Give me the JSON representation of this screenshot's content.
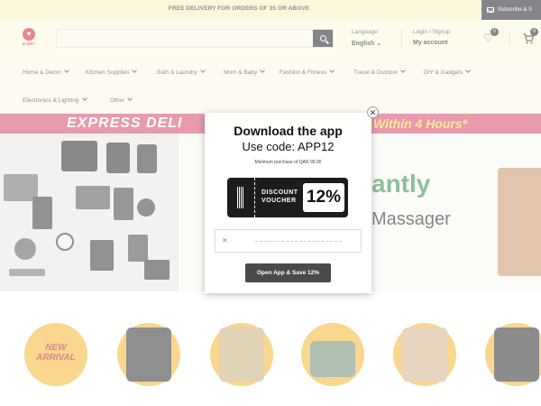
{
  "topbar": {
    "promo": "FREE DELIVERY FOR ORDERS OF 35 OR ABOVE",
    "subscribe": "Subscribe & S"
  },
  "brand": {
    "logo_text": "E-SKY"
  },
  "search": {
    "placeholder": ""
  },
  "header": {
    "language_label": "Language",
    "language_value": "English",
    "login_label": "Login / Signup",
    "account_label": "My account",
    "wishlist_count": "0",
    "cart_count": "0"
  },
  "nav": {
    "items": [
      "Home & Decor",
      "Kitchen Supplies",
      "Bath & Laundry",
      "Mom & Baby",
      "Fashion & Fitness",
      "Travel & Outdoor",
      "DIY & Gadgets",
      "Electronics & Lighting",
      "Other"
    ]
  },
  "banner": {
    "express_text": "EXPRESS DELI",
    "within_text": "Within 4 Hours*",
    "headline1": "antly",
    "headline2": "Massager"
  },
  "modal": {
    "title": "Download the app",
    "code_line": "Use code: APP12",
    "min_purchase": "Minimum purchase of QAR 99.00",
    "voucher_label": "DISCOUNT VOUCHER",
    "voucher_percent": "12%",
    "cta": "Open App & Save 12%"
  },
  "categories": {
    "first_label": "NEW ARRIVAL"
  },
  "colors": {
    "accent": "#d44a6a",
    "logo": "#d7262a",
    "circle": "#f4b733",
    "topbar": "#f6f1bd"
  }
}
